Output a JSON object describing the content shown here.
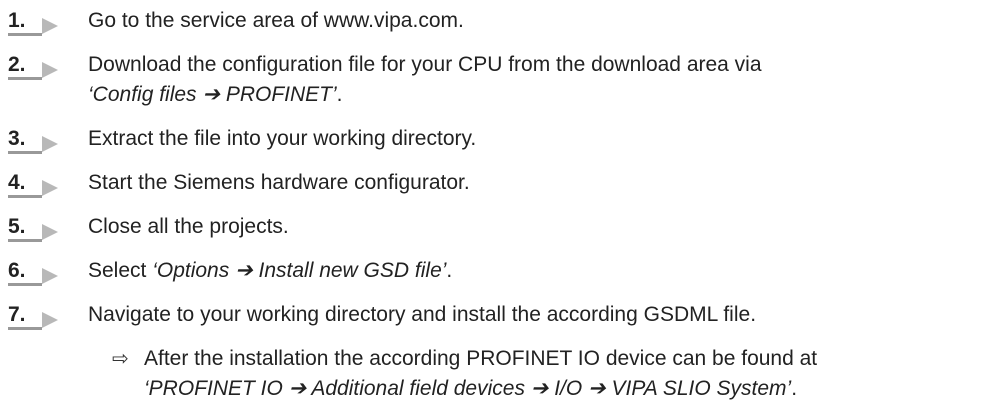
{
  "steps": [
    {
      "number": "1.",
      "line1": "Go to the service area of www.vipa.com."
    },
    {
      "number": "2.",
      "line1": "Download the configuration file for your CPU from the download area via",
      "line2": "‘Config files ➔ PROFINET’",
      "line2_suffix": "."
    },
    {
      "number": "3.",
      "line1": "Extract the file into your working directory."
    },
    {
      "number": "4.",
      "line1": "Start the Siemens hardware configurator."
    },
    {
      "number": "5.",
      "line1": "Close all the projects."
    },
    {
      "number": "6.",
      "line1_prefix": "Select ",
      "line1_italic": "‘Options ➔ Install new GSD file’",
      "line1_suffix": "."
    },
    {
      "number": "7.",
      "line1": "Navigate to your working directory and install the according GSDML file."
    }
  ],
  "result": {
    "arrow": "⇨",
    "line1": "After the installation the according PROFINET IO device can be found at",
    "line2": "‘PROFINET IO ➔ Additional field devices ➔ I/O ➔ VIPA SLIO System’",
    "line2_suffix": "."
  }
}
